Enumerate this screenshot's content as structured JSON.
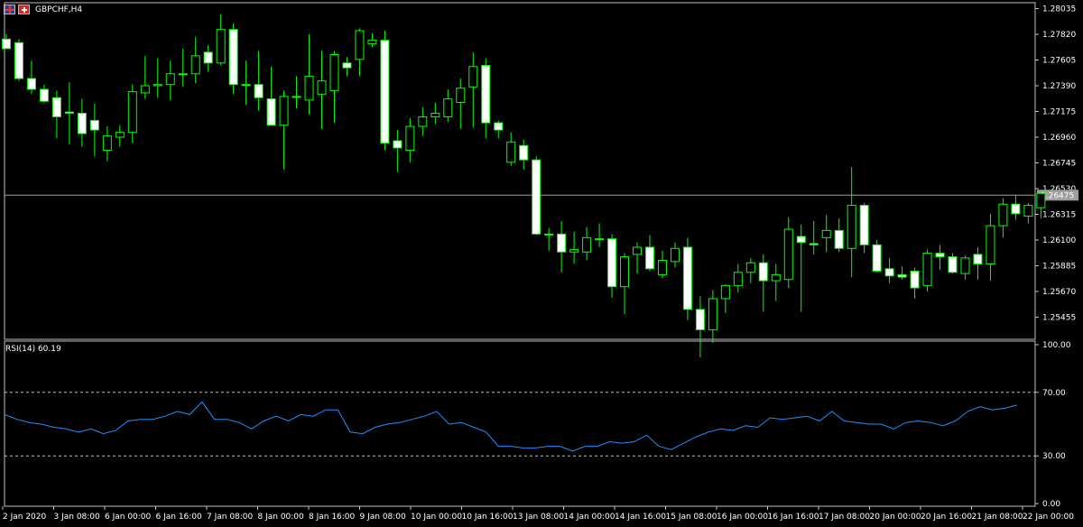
{
  "window": {
    "symbol_title": "GBPCHF,H4"
  },
  "colors": {
    "bull_body": "#000000",
    "bear_body": "#ffffff",
    "wick": "#00ff00",
    "rsi_line": "#1e90ff",
    "grid_line": "#c0c0c0",
    "current_price_line": "#9e9e9e",
    "current_price_box": "#9e9e9e"
  },
  "icons": [
    "gb-flag-icon",
    "ch-flag-icon"
  ],
  "chart_data": [
    {
      "type": "candlestick",
      "title": "GBPCHF,H4",
      "y_ticks": [
        "1.28035",
        "1.27820",
        "1.27605",
        "1.27390",
        "1.27175",
        "1.26960",
        "1.26745",
        "1.26530",
        "1.26315",
        "1.26100",
        "1.25885",
        "1.25670",
        "1.25455"
      ],
      "ylim": [
        1.2512,
        1.2805
      ],
      "current_price": "1.26475",
      "candles": [
        {
          "o": 1.2778,
          "h": 1.2782,
          "l": 1.277,
          "c": 1.277
        },
        {
          "o": 1.2775,
          "h": 1.2778,
          "l": 1.2743,
          "c": 1.2745
        },
        {
          "o": 1.2745,
          "h": 1.276,
          "l": 1.2732,
          "c": 1.2736
        },
        {
          "o": 1.2736,
          "h": 1.274,
          "l": 1.2725,
          "c": 1.2726
        },
        {
          "o": 1.2729,
          "h": 1.2735,
          "l": 1.2695,
          "c": 1.2713
        },
        {
          "o": 1.2717,
          "h": 1.2742,
          "l": 1.269,
          "c": 1.2716
        },
        {
          "o": 1.2716,
          "h": 1.2728,
          "l": 1.2688,
          "c": 1.2699
        },
        {
          "o": 1.271,
          "h": 1.2724,
          "l": 1.268,
          "c": 1.2702
        },
        {
          "o": 1.2685,
          "h": 1.2705,
          "l": 1.2676,
          "c": 1.2697
        },
        {
          "o": 1.2696,
          "h": 1.2706,
          "l": 1.2688,
          "c": 1.27
        },
        {
          "o": 1.27,
          "h": 1.274,
          "l": 1.2691,
          "c": 1.2734
        },
        {
          "o": 1.2733,
          "h": 1.2764,
          "l": 1.2728,
          "c": 1.2739
        },
        {
          "o": 1.2739,
          "h": 1.2762,
          "l": 1.2729,
          "c": 1.274
        },
        {
          "o": 1.274,
          "h": 1.276,
          "l": 1.2727,
          "c": 1.2749
        },
        {
          "o": 1.2749,
          "h": 1.277,
          "l": 1.2738,
          "c": 1.2749
        },
        {
          "o": 1.2749,
          "h": 1.278,
          "l": 1.2741,
          "c": 1.2764
        },
        {
          "o": 1.2767,
          "h": 1.2773,
          "l": 1.2751,
          "c": 1.2758
        },
        {
          "o": 1.2758,
          "h": 1.2799,
          "l": 1.2756,
          "c": 1.2786
        },
        {
          "o": 1.2786,
          "h": 1.2791,
          "l": 1.2732,
          "c": 1.274
        },
        {
          "o": 1.274,
          "h": 1.276,
          "l": 1.2723,
          "c": 1.274
        },
        {
          "o": 1.274,
          "h": 1.2768,
          "l": 1.2718,
          "c": 1.2729
        },
        {
          "o": 1.2728,
          "h": 1.2755,
          "l": 1.2712,
          "c": 1.2706
        },
        {
          "o": 1.2706,
          "h": 1.2735,
          "l": 1.2669,
          "c": 1.273
        },
        {
          "o": 1.273,
          "h": 1.2747,
          "l": 1.272,
          "c": 1.273
        },
        {
          "o": 1.2727,
          "h": 1.2782,
          "l": 1.2715,
          "c": 1.2747
        },
        {
          "o": 1.2732,
          "h": 1.2768,
          "l": 1.2703,
          "c": 1.2743
        },
        {
          "o": 1.2735,
          "h": 1.2768,
          "l": 1.2708,
          "c": 1.2765
        },
        {
          "o": 1.2758,
          "h": 1.2763,
          "l": 1.2747,
          "c": 1.2754
        },
        {
          "o": 1.2761,
          "h": 1.2787,
          "l": 1.2747,
          "c": 1.2785
        },
        {
          "o": 1.2774,
          "h": 1.2783,
          "l": 1.2771,
          "c": 1.2777
        },
        {
          "o": 1.2777,
          "h": 1.2785,
          "l": 1.2685,
          "c": 1.2691
        },
        {
          "o": 1.2693,
          "h": 1.2702,
          "l": 1.2667,
          "c": 1.2687
        },
        {
          "o": 1.2685,
          "h": 1.2712,
          "l": 1.2675,
          "c": 1.2705
        },
        {
          "o": 1.2705,
          "h": 1.2721,
          "l": 1.2697,
          "c": 1.2713
        },
        {
          "o": 1.2713,
          "h": 1.2725,
          "l": 1.2707,
          "c": 1.2716
        },
        {
          "o": 1.2713,
          "h": 1.2736,
          "l": 1.2709,
          "c": 1.2728
        },
        {
          "o": 1.2725,
          "h": 1.2745,
          "l": 1.2703,
          "c": 1.2737
        },
        {
          "o": 1.2738,
          "h": 1.2767,
          "l": 1.2704,
          "c": 1.2755
        },
        {
          "o": 1.2756,
          "h": 1.2762,
          "l": 1.2695,
          "c": 1.2708
        },
        {
          "o": 1.2708,
          "h": 1.271,
          "l": 1.2695,
          "c": 1.2702
        },
        {
          "o": 1.2675,
          "h": 1.27,
          "l": 1.2672,
          "c": 1.2692
        },
        {
          "o": 1.2689,
          "h": 1.2694,
          "l": 1.2669,
          "c": 1.2677
        },
        {
          "o": 1.2677,
          "h": 1.268,
          "l": 1.2614,
          "c": 1.2615
        },
        {
          "o": 1.2615,
          "h": 1.262,
          "l": 1.2601,
          "c": 1.2615
        },
        {
          "o": 1.2615,
          "h": 1.2626,
          "l": 1.2583,
          "c": 1.26
        },
        {
          "o": 1.26,
          "h": 1.2617,
          "l": 1.259,
          "c": 1.2602
        },
        {
          "o": 1.26,
          "h": 1.2621,
          "l": 1.2593,
          "c": 1.2612
        },
        {
          "o": 1.2611,
          "h": 1.2624,
          "l": 1.2604,
          "c": 1.2611
        },
        {
          "o": 1.2611,
          "h": 1.2615,
          "l": 1.2562,
          "c": 1.2571
        },
        {
          "o": 1.2571,
          "h": 1.2599,
          "l": 1.2548,
          "c": 1.2596
        },
        {
          "o": 1.2598,
          "h": 1.2608,
          "l": 1.2582,
          "c": 1.2604
        },
        {
          "o": 1.2604,
          "h": 1.2614,
          "l": 1.2584,
          "c": 1.2586
        },
        {
          "o": 1.2581,
          "h": 1.2601,
          "l": 1.2578,
          "c": 1.2593
        },
        {
          "o": 1.2592,
          "h": 1.2608,
          "l": 1.2587,
          "c": 1.2603
        },
        {
          "o": 1.2604,
          "h": 1.2612,
          "l": 1.2543,
          "c": 1.2552
        },
        {
          "o": 1.2552,
          "h": 1.2563,
          "l": 1.2512,
          "c": 1.2535
        },
        {
          "o": 1.2535,
          "h": 1.2568,
          "l": 1.2524,
          "c": 1.2561
        },
        {
          "o": 1.2561,
          "h": 1.2573,
          "l": 1.2549,
          "c": 1.2572
        },
        {
          "o": 1.2572,
          "h": 1.259,
          "l": 1.2566,
          "c": 1.2583
        },
        {
          "o": 1.2583,
          "h": 1.2595,
          "l": 1.2574,
          "c": 1.2591
        },
        {
          "o": 1.2591,
          "h": 1.2598,
          "l": 1.255,
          "c": 1.2576
        },
        {
          "o": 1.2576,
          "h": 1.259,
          "l": 1.2559,
          "c": 1.2581
        },
        {
          "o": 1.2577,
          "h": 1.2629,
          "l": 1.257,
          "c": 1.2619
        },
        {
          "o": 1.2613,
          "h": 1.2623,
          "l": 1.255,
          "c": 1.2608
        },
        {
          "o": 1.2607,
          "h": 1.2626,
          "l": 1.2598,
          "c": 1.2606
        },
        {
          "o": 1.2612,
          "h": 1.2631,
          "l": 1.26,
          "c": 1.2618
        },
        {
          "o": 1.2618,
          "h": 1.2628,
          "l": 1.26,
          "c": 1.2603
        },
        {
          "o": 1.2603,
          "h": 1.2671,
          "l": 1.2579,
          "c": 1.2639
        },
        {
          "o": 1.2639,
          "h": 1.2641,
          "l": 1.2599,
          "c": 1.2606
        },
        {
          "o": 1.2606,
          "h": 1.261,
          "l": 1.2583,
          "c": 1.2584
        },
        {
          "o": 1.2586,
          "h": 1.2595,
          "l": 1.2574,
          "c": 1.258
        },
        {
          "o": 1.2581,
          "h": 1.2588,
          "l": 1.2577,
          "c": 1.2579
        },
        {
          "o": 1.2584,
          "h": 1.2587,
          "l": 1.2561,
          "c": 1.257
        },
        {
          "o": 1.2572,
          "h": 1.2602,
          "l": 1.2567,
          "c": 1.2599
        },
        {
          "o": 1.2599,
          "h": 1.2606,
          "l": 1.2585,
          "c": 1.2596
        },
        {
          "o": 1.2596,
          "h": 1.2599,
          "l": 1.2582,
          "c": 1.2583
        },
        {
          "o": 1.2582,
          "h": 1.2597,
          "l": 1.2577,
          "c": 1.2595
        },
        {
          "o": 1.2598,
          "h": 1.2604,
          "l": 1.2577,
          "c": 1.259
        },
        {
          "o": 1.259,
          "h": 1.2632,
          "l": 1.2576,
          "c": 1.2622
        },
        {
          "o": 1.2622,
          "h": 1.2645,
          "l": 1.2612,
          "c": 1.264
        },
        {
          "o": 1.264,
          "h": 1.2648,
          "l": 1.2627,
          "c": 1.2632
        },
        {
          "o": 1.263,
          "h": 1.2641,
          "l": 1.2624,
          "c": 1.2639
        },
        {
          "o": 1.2637,
          "h": 1.2651,
          "l": 1.2628,
          "c": 1.2649
        }
      ],
      "x_ticks": [
        "2 Jan 2020",
        "3 Jan 08:00",
        "6 Jan 00:00",
        "6 Jan 16:00",
        "7 Jan 08:00",
        "8 Jan 00:00",
        "8 Jan 16:00",
        "9 Jan 08:00",
        "10 Jan 00:00",
        "10 Jan 16:00",
        "13 Jan 08:00",
        "14 Jan 00:00",
        "14 Jan 16:00",
        "15 Jan 08:00",
        "16 Jan 00:00",
        "16 Jan 16:00",
        "17 Jan 08:00",
        "20 Jan 00:00",
        "20 Jan 16:00",
        "21 Jan 08:00",
        "22 Jan 00:00"
      ]
    },
    {
      "type": "line",
      "title": "RSI(14) 60.19",
      "ylim": [
        0,
        100
      ],
      "y_ticks": [
        "100.00",
        "70.00",
        "30.00",
        "0.00"
      ],
      "levels": [
        70,
        30
      ],
      "series": [
        {
          "name": "RSI(14)",
          "values": [
            56,
            53,
            51,
            50,
            48,
            47,
            45,
            47,
            44,
            46,
            52,
            53,
            53,
            55,
            58,
            56,
            64,
            53,
            53,
            51,
            47,
            52,
            55,
            52,
            56,
            55,
            59,
            59,
            45,
            44,
            48,
            50,
            51,
            53,
            55,
            58,
            50,
            51,
            48,
            45,
            36,
            36,
            35,
            35,
            36,
            36,
            33,
            36,
            36,
            39,
            38,
            39,
            43,
            36,
            34,
            38,
            42,
            45,
            47,
            46,
            49,
            48,
            54,
            53,
            54,
            55,
            52,
            58,
            52,
            51,
            50,
            50,
            47,
            51,
            52,
            51,
            49,
            52,
            58,
            61,
            59,
            60,
            62
          ]
        }
      ]
    }
  ]
}
